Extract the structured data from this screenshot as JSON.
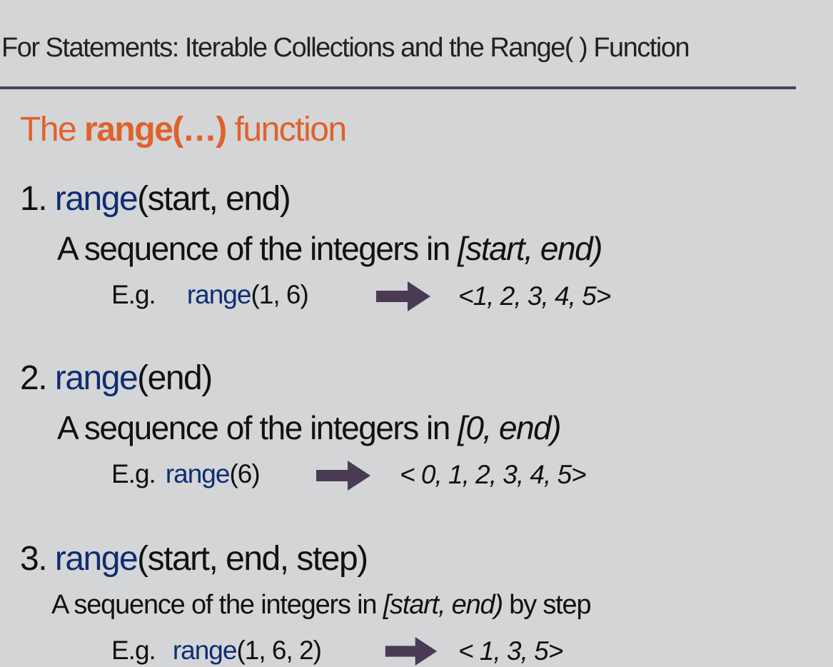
{
  "slide_title": "For Statements: Iterable Collections and the Range( ) Function",
  "heading": {
    "pre": "The ",
    "bold": "range(…)",
    "post": " function",
    "color": "#e0622a"
  },
  "accent_fn_color": "#0f2d72",
  "arrow_color": "#4a3b55",
  "items": [
    {
      "num": "1. ",
      "fn": "range",
      "args": "(start, end)",
      "desc_pre": "A sequence of the integers in ",
      "desc_it": "[start, end)",
      "desc_post": "",
      "eg_label": "E.g.",
      "eg_fn": "range",
      "eg_args": "(1, 6)",
      "result": "<1, 2, 3, 4, 5>"
    },
    {
      "num": "2. ",
      "fn": "range",
      "args": "(end)",
      "desc_pre": "A sequence of the integers in ",
      "desc_it": "[0, end)",
      "desc_post": "",
      "eg_label": "E.g.",
      "eg_fn": "range",
      "eg_args": "(6)",
      "result": "< 0, 1, 2, 3, 4, 5>"
    },
    {
      "num": "3. ",
      "fn": "range",
      "args": "(start, end, step)",
      "desc_pre": "A sequence of the integers in ",
      "desc_it": "[start, end)",
      "desc_post": " by step",
      "eg_label": "E.g.",
      "eg_fn": "range",
      "eg_args": "(1, 6, 2)",
      "result": "< 1, 3, 5>"
    }
  ]
}
